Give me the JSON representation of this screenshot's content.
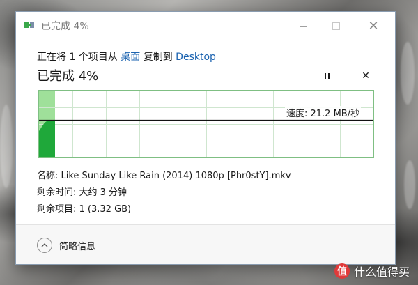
{
  "window": {
    "title": "已完成 4%",
    "minimize_icon": "minimize-icon",
    "maximize_icon": "maximize-icon",
    "close_icon": "close-icon"
  },
  "operation": {
    "prefix": "正在将 1 个项目从 ",
    "source": "桌面",
    "middle": " 复制到 ",
    "destination": "Desktop",
    "link_color": "#1b63b0"
  },
  "progress": {
    "title": "已完成 4%",
    "percent": 4,
    "pause_icon": "pause-icon",
    "stop_icon": "close-icon"
  },
  "graph": {
    "speed_text": "速度: 21.2 MB/秒",
    "fill_color": "#1fa83a",
    "completed_shade": "#9fe09a",
    "grid_color": "#cfe6cf"
  },
  "details": {
    "name": "名称: Like Sunday Like Rain (2014) 1080p [Phr0stY].mkv",
    "time_remaining": "剩余时间: 大约 3 分钟",
    "items_remaining": "剩余项目: 1 (3.32 GB)"
  },
  "footer": {
    "toggle_label": "简略信息",
    "toggle_icon": "chevron-up-icon"
  },
  "watermark": {
    "badge": "值",
    "text": "什么值得买"
  }
}
